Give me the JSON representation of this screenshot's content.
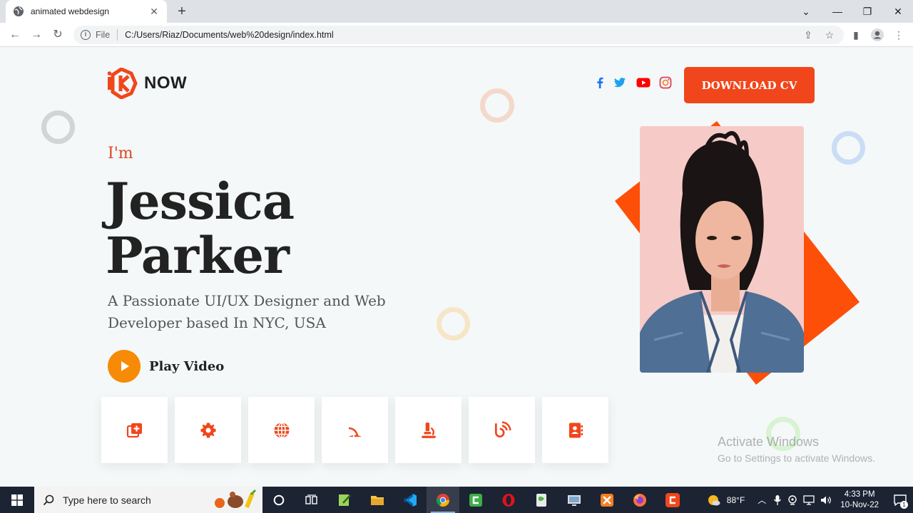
{
  "browser": {
    "tab_title": "animated webdesign",
    "close_tab": "✕",
    "new_tab": "+",
    "address_scheme": "File",
    "url": "C:/Users/Riaz/Documents/web%20design/index.html"
  },
  "site": {
    "logo_text": "NOW",
    "logo_prefix": "i",
    "cta_label": "DOWNLOAD CV",
    "greeting": "I'm",
    "first_name": "Jessica",
    "last_name": "Parker",
    "tagline": "A Passionate UI/UX Designer and Web Developer based In NYC, USA",
    "play_label": "Play Video",
    "social": [
      "facebook-icon",
      "twitter-icon",
      "youtube-icon",
      "instagram-icon"
    ],
    "service_icons": [
      "add-copy-icon",
      "gear-icon",
      "globe-icon",
      "rss-icon",
      "microscope-icon",
      "analytics-icon",
      "contact-book-icon"
    ]
  },
  "watermark": {
    "line1": "Activate Windows",
    "line2": "Go to Settings to activate Windows."
  },
  "taskbar": {
    "search_placeholder": "Type here to search",
    "temperature": "88°F",
    "time": "4:33 PM",
    "date": "10-Nov-22",
    "notification_count": "1"
  },
  "colors": {
    "accent": "#f1461b",
    "play": "#f78a07",
    "facebook": "#1877f2",
    "twitter": "#1da1f2",
    "youtube": "#ff0000",
    "instagram": "#e1306c"
  }
}
